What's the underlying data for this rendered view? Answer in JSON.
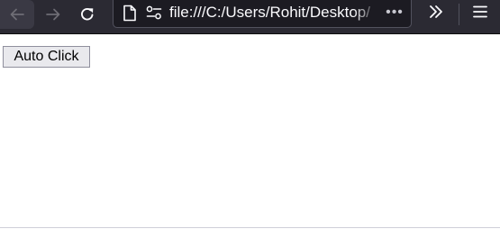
{
  "browser": {
    "address_bar": {
      "url": "file:///C:/Users/Rohit/Desktop/",
      "page_actions_glyph": "•••"
    },
    "icons": {
      "back": "back-arrow-icon",
      "forward": "forward-arrow-icon",
      "reload": "reload-icon",
      "page": "page-icon",
      "permissions": "permissions-icon",
      "overflow": "chevron-double-right-icon",
      "menu": "hamburger-menu-icon"
    },
    "colors": {
      "toolbar": "#2b2a33",
      "urlbar": "#1c1b22",
      "icon": "#fbfbfe",
      "disabled_icon": "#6e6d75"
    }
  },
  "page": {
    "auto_click_label": "Auto Click"
  }
}
